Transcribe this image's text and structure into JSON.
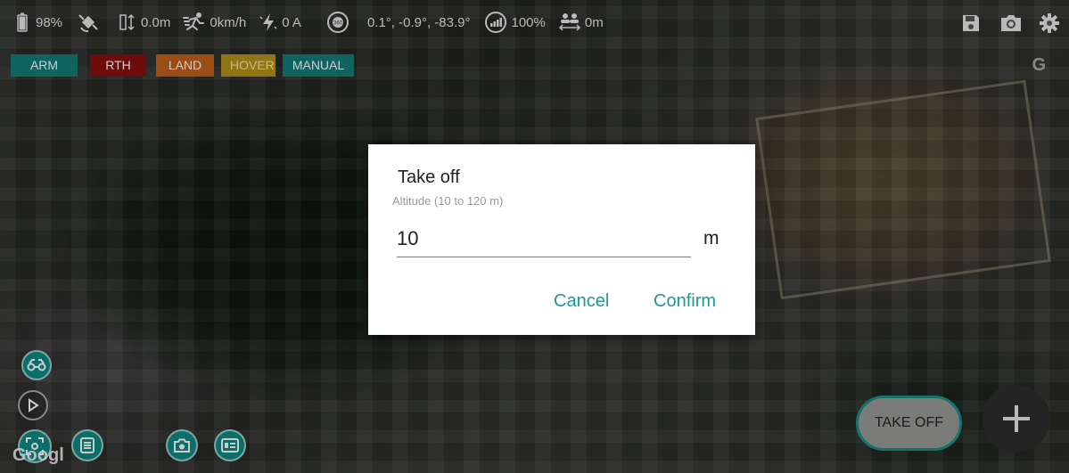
{
  "status": {
    "battery": "98%",
    "altitude": "0.0m",
    "speed": "0km/h",
    "current": "0 A",
    "orientation": "0.1°, -0.9°, -83.9°",
    "signal": "100%",
    "distance": "0m"
  },
  "modes": {
    "arm": "ARM",
    "rth": "RTH",
    "land": "LAND",
    "hover": "HOVER",
    "manual": "MANUAL"
  },
  "map": {
    "watermark": "G",
    "google_label": "Googl"
  },
  "dialog": {
    "title": "Take off",
    "hint": "Altitude (10 to 120 m)",
    "value": "10",
    "unit": "m",
    "cancel": "Cancel",
    "confirm": "Confirm"
  },
  "actions": {
    "take_off": "TAKE OFF"
  },
  "colors": {
    "accent": "#157d78",
    "rth": "#8a0e0e",
    "land": "#c4611d",
    "hover": "#b39318",
    "dialog_button": "#1a9a95"
  }
}
